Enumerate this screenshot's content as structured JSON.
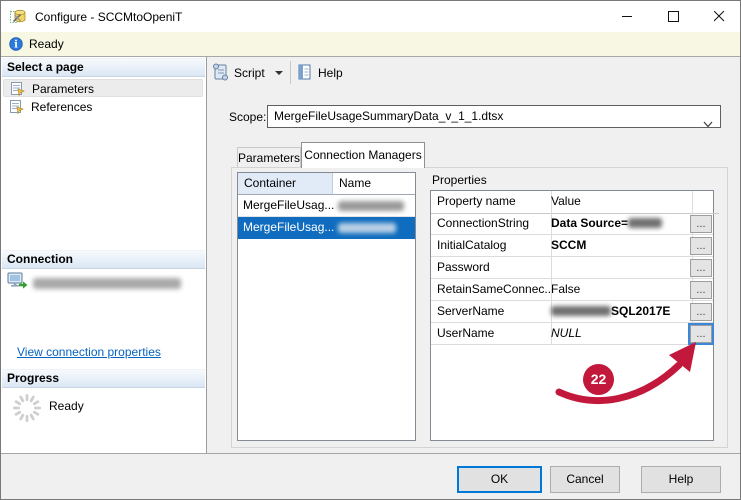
{
  "window": {
    "title": "Configure - SCCMtoOpeniT"
  },
  "infobar": {
    "status": "Ready"
  },
  "sidebar": {
    "pages_header": "Select a page",
    "pages": [
      {
        "label": "Parameters"
      },
      {
        "label": "References"
      }
    ],
    "connection_header": "Connection",
    "connection_name_redacted": true,
    "connection_link": "View connection properties",
    "progress_header": "Progress",
    "progress_status": "Ready"
  },
  "toolbar": {
    "script": "Script",
    "help": "Help"
  },
  "scope": {
    "label": "Scope:",
    "value": "MergeFileUsageSummaryData_v_1_1.dtsx"
  },
  "tabs": {
    "parameters": "Parameters",
    "connection_managers": "Connection Managers"
  },
  "managers": {
    "columns": {
      "container": "Container",
      "name": "Name"
    },
    "rows": [
      {
        "container": "MergeFileUsag...",
        "name_redacted": true,
        "selected": false
      },
      {
        "container": "MergeFileUsag...",
        "name_redacted": true,
        "selected": true
      }
    ]
  },
  "properties": {
    "title": "Properties",
    "columns": {
      "name": "Property name",
      "value": "Value"
    },
    "ellipsis": "...",
    "rows": [
      {
        "name": "ConnectionString",
        "value": "Data Source=",
        "value_redacted_suffix": true,
        "bold": true
      },
      {
        "name": "InitialCatalog",
        "value": "SCCM",
        "bold": true
      },
      {
        "name": "Password",
        "value": ""
      },
      {
        "name": "RetainSameConnec...",
        "value": "False"
      },
      {
        "name": "ServerName",
        "value": "SQL2017E",
        "value_redacted_prefix": true,
        "bold": true
      },
      {
        "name": "UserName",
        "value": "NULL",
        "italic": true,
        "button_focused": true
      }
    ]
  },
  "annotation": {
    "badge": "22",
    "color": "#c2183b"
  },
  "footer": {
    "ok": "OK",
    "cancel": "Cancel",
    "help": "Help"
  },
  "colors": {
    "selection_blue": "#0f6cbe",
    "accent_blue": "#0078d7",
    "link_blue": "#0563c1",
    "infobar_bg": "#f7f7e3",
    "badge_red": "#c2183b"
  }
}
